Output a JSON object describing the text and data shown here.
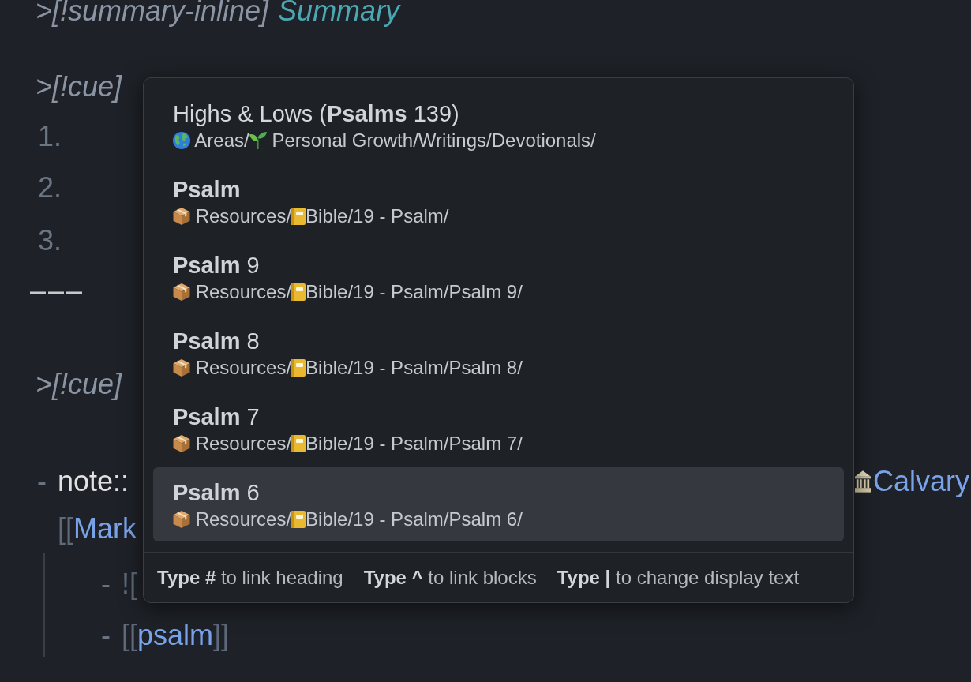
{
  "editor": {
    "lines": [
      {
        "kind": "callout",
        "segments": [
          {
            "kind": "marker",
            "text": ">[!summary-inline]"
          },
          {
            "kind": "title",
            "text": "Summary"
          }
        ]
      },
      {
        "kind": "callout",
        "segments": [
          {
            "kind": "marker",
            "text": ">[!cue]"
          }
        ]
      },
      {
        "kind": "numbered",
        "segments": [
          {
            "kind": "number",
            "text": "1."
          }
        ]
      },
      {
        "kind": "numbered",
        "segments": [
          {
            "kind": "number",
            "text": "2."
          }
        ]
      },
      {
        "kind": "numbered",
        "segments": [
          {
            "kind": "number",
            "text": "3."
          }
        ]
      },
      {
        "kind": "rule",
        "segments": [
          {
            "kind": "rule",
            "text": "–––"
          }
        ]
      },
      {
        "kind": "callout",
        "segments": [
          {
            "kind": "marker",
            "text": ">[!cue]"
          }
        ]
      },
      {
        "kind": "bullet",
        "segments": [
          {
            "kind": "bullet",
            "text": "-"
          },
          {
            "kind": "key",
            "text": "note::"
          },
          {
            "kind": "building"
          },
          {
            "kind": "link",
            "text": "Calvary"
          }
        ],
        "continuation": [
          {
            "kind": "bracket",
            "text": "[["
          },
          {
            "kind": "link",
            "text": "Mark"
          }
        ],
        "children": [
          {
            "segments": [
              {
                "kind": "bullet",
                "text": "-"
              },
              {
                "kind": "bracket",
                "text": "!["
              }
            ]
          },
          {
            "segments": [
              {
                "kind": "bullet",
                "text": "-"
              },
              {
                "kind": "bracket",
                "text": "[["
              },
              {
                "kind": "link",
                "text": "psalm"
              },
              {
                "kind": "bracket",
                "text": "]]"
              }
            ]
          }
        ]
      }
    ]
  },
  "link_suggestions": {
    "items": [
      {
        "title": "Highs & Lows (**Psalms** 139)",
        "bold": false,
        "path": [
          {
            "kind": "globe"
          },
          {
            "kind": "text",
            "text": " Areas/"
          },
          {
            "kind": "sprout"
          },
          {
            "kind": "text",
            "text": " Personal Growth/Writings/Devotionals/"
          }
        ],
        "selected": false
      },
      {
        "title": "Psalm",
        "bold": true,
        "path": [
          {
            "kind": "box"
          },
          {
            "kind": "text",
            "text": " Resources/"
          },
          {
            "kind": "notebook"
          },
          {
            "kind": "text",
            "text": "Bible/19 - Psalm/"
          }
        ],
        "selected": false
      },
      {
        "title": "**Psalm** 9",
        "bold": false,
        "path": [
          {
            "kind": "box"
          },
          {
            "kind": "text",
            "text": " Resources/"
          },
          {
            "kind": "notebook"
          },
          {
            "kind": "text",
            "text": "Bible/19 - Psalm/Psalm 9/"
          }
        ],
        "selected": false
      },
      {
        "title": "**Psalm** 8",
        "bold": false,
        "path": [
          {
            "kind": "box"
          },
          {
            "kind": "text",
            "text": " Resources/"
          },
          {
            "kind": "notebook"
          },
          {
            "kind": "text",
            "text": "Bible/19 - Psalm/Psalm 8/"
          }
        ],
        "selected": false
      },
      {
        "title": "**Psalm** 7",
        "bold": false,
        "path": [
          {
            "kind": "box"
          },
          {
            "kind": "text",
            "text": " Resources/"
          },
          {
            "kind": "notebook"
          },
          {
            "kind": "text",
            "text": "Bible/19 - Psalm/Psalm 7/"
          }
        ],
        "selected": false
      },
      {
        "title": "**Psalm** 6",
        "bold": false,
        "path": [
          {
            "kind": "box"
          },
          {
            "kind": "text",
            "text": " Resources/"
          },
          {
            "kind": "notebook"
          },
          {
            "kind": "text",
            "text": "Bible/19 - Psalm/Psalm 6/"
          }
        ],
        "selected": true
      }
    ],
    "hints": [
      "**Type #** to link heading",
      "**Type ^** to link blocks",
      "**Type |** to change display text"
    ]
  }
}
